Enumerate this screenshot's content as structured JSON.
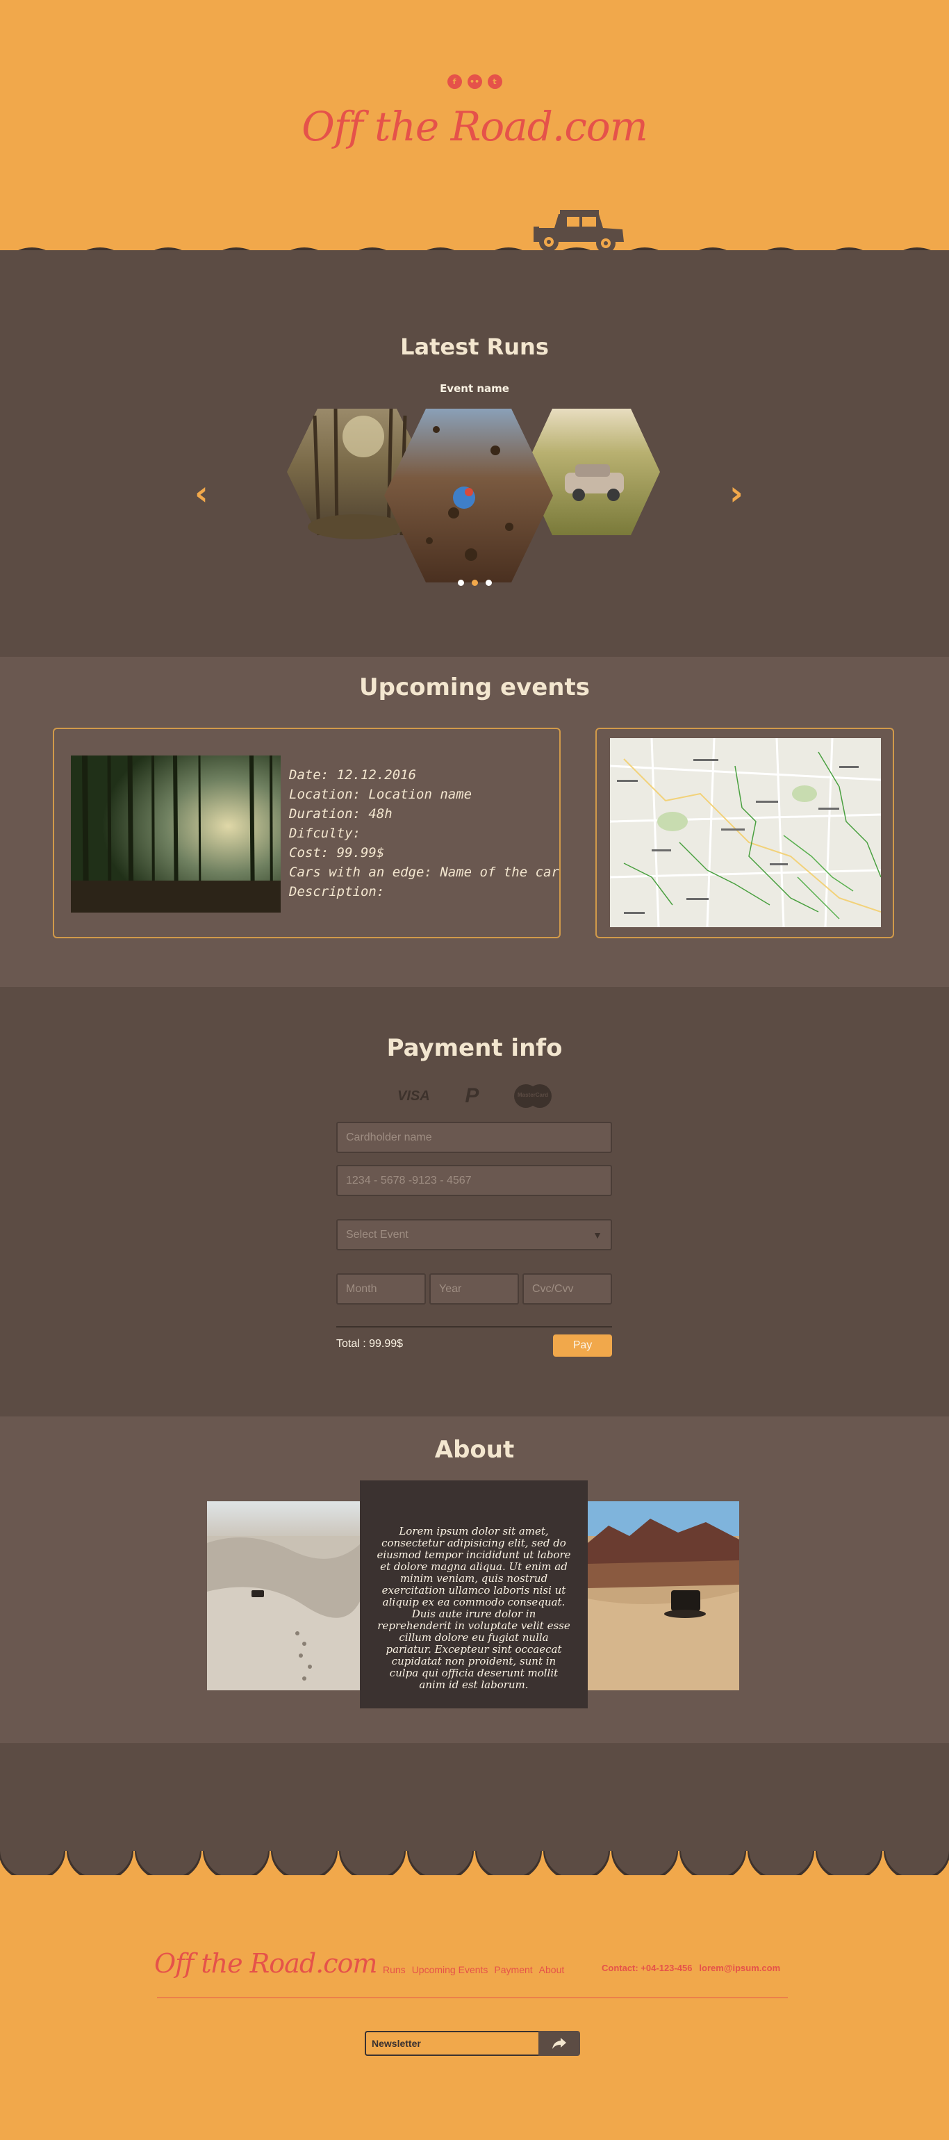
{
  "header": {
    "socials": [
      {
        "icon": "facebook-icon",
        "glyph": "f"
      },
      {
        "icon": "flickr-icon",
        "glyph": "••"
      },
      {
        "icon": "tumblr-icon",
        "glyph": "t"
      }
    ],
    "logo": "Off the Road.com"
  },
  "latest_runs": {
    "title": "Latest Runs",
    "event_name": "Event name",
    "prev_arrow": "‹",
    "next_arrow": "›",
    "slides": [
      "forest-run",
      "mud-splash",
      "field-car"
    ],
    "active_dot": 1
  },
  "upcoming": {
    "title": "Upcoming events",
    "date": "Date: 12.12.2016",
    "location": "Location: Location name",
    "duration": "Duration: 48h",
    "difficulty": "Difculty:",
    "cost": "Cost: 99.99$",
    "cars": "Cars with an edge: Name of the car",
    "description": "Description:"
  },
  "payment": {
    "title": "Payment info",
    "cards": [
      "VISA",
      "P",
      "MasterCard"
    ],
    "cardholder_placeholder": "Cardholder name",
    "number_placeholder": "1234 - 5678 -9123 - 4567",
    "select_event": "Select Event",
    "month_placeholder": "Month",
    "year_placeholder": "Year",
    "cvc_placeholder": "Cvc/Cvv",
    "total": "Total : 99.99$",
    "pay_label": "Pay"
  },
  "about": {
    "title": "About",
    "text": "Lorem ipsum dolor sit amet, consectetur adipisicing elit, sed do eiusmod tempor incididunt ut labore et dolore magna aliqua. Ut enim ad minim veniam, quis nostrud exercitation ullamco laboris nisi ut aliquip ex ea commodo consequat. Duis aute irure dolor in reprehenderit in voluptate velit esse cillum dolore eu fugiat nulla pariatur. Excepteur sint occaecat cupidatat non proident, sunt in culpa qui officia deserunt mollit anim id est laborum."
  },
  "footer": {
    "logo": "Off the Road.com",
    "nav": [
      "Runs",
      "Upcoming Events",
      "Payment",
      "About"
    ],
    "phone": "Contact: +04-123-456",
    "email": "lorem@ipsum.com",
    "newsletter_placeholder": "Newsletter"
  },
  "colors": {
    "orange": "#f1a84b",
    "red": "#e5524a",
    "brown_dark": "#5c4c44",
    "brown_light": "#6a5850"
  }
}
